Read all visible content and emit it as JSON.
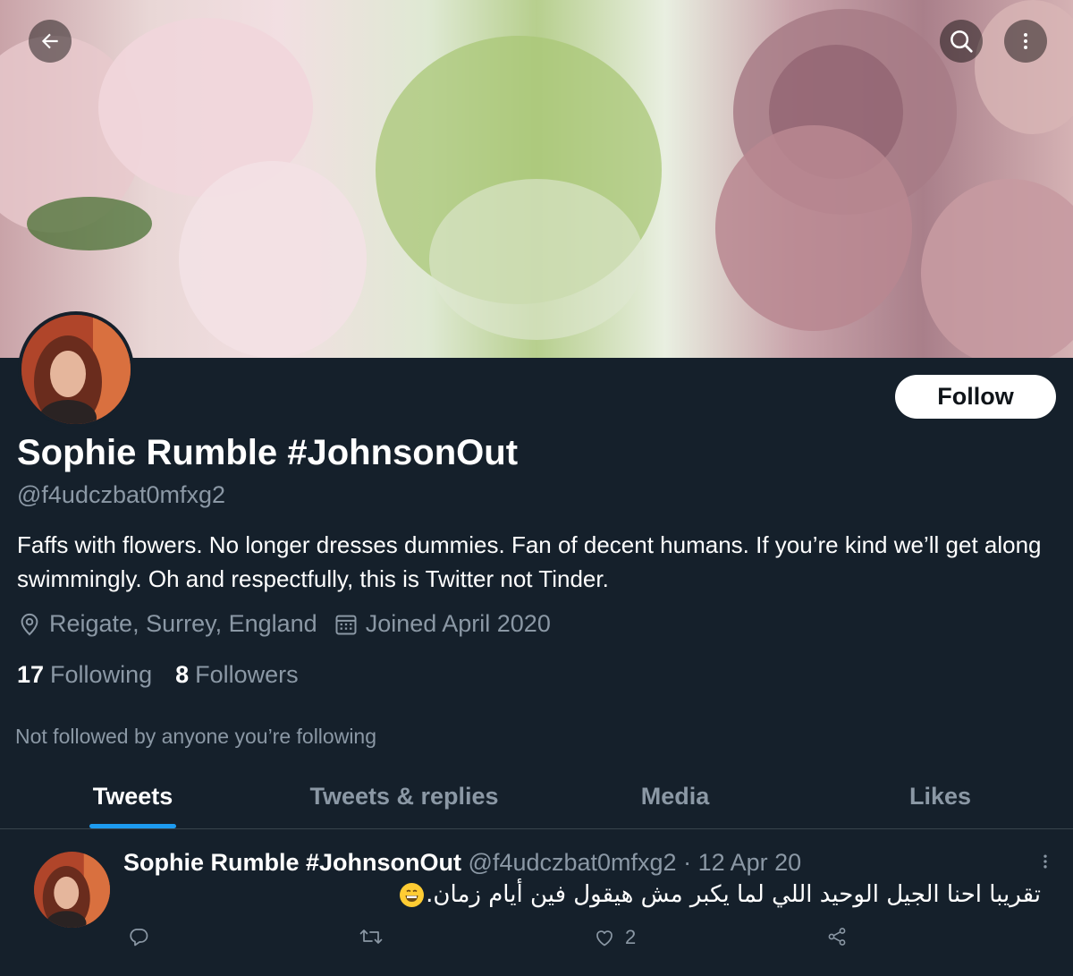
{
  "profile": {
    "name": "Sophie Rumble #JohnsonOut",
    "handle": "@f4udczbat0mfxg2",
    "bio": "Faffs with flowers. No longer dresses dummies. Fan of decent humans. If you’re kind we’ll get along swimmingly. Oh and respectfully, this is Twitter not Tinder.",
    "location": "Reigate, Surrey, England",
    "joined": "Joined April 2020",
    "following_count": "17",
    "following_label": "Following",
    "followers_count": "8",
    "followers_label": "Followers",
    "not_followed": "Not followed by anyone you’re following",
    "follow_label": "Follow"
  },
  "tabs": [
    {
      "label": "Tweets",
      "active": true
    },
    {
      "label": "Tweets & replies",
      "active": false
    },
    {
      "label": "Media",
      "active": false
    },
    {
      "label": "Likes",
      "active": false
    }
  ],
  "tweet": {
    "name": "Sophie Rumble #JohnsonOut",
    "handle": "@f4udczbat0mfxg2",
    "date": " · 12 Apr 20",
    "text": "تقريبا احنا الجيل الوحيد اللي لما يكبر مش هيقول فين أيام زمان.",
    "like_count": "2"
  },
  "icons": {
    "back": "back-arrow-icon",
    "search": "search-icon",
    "more": "more-vertical-icon",
    "location": "location-pin-icon",
    "calendar": "calendar-icon",
    "reply": "reply-icon",
    "retweet": "retweet-icon",
    "like": "heart-icon",
    "share": "share-icon",
    "emoji": "grinning-face-emoji"
  },
  "colors": {
    "background": "#15202b",
    "accent": "#1d9bf0",
    "secondary_text": "#8b98a5",
    "divider": "#38444d"
  }
}
